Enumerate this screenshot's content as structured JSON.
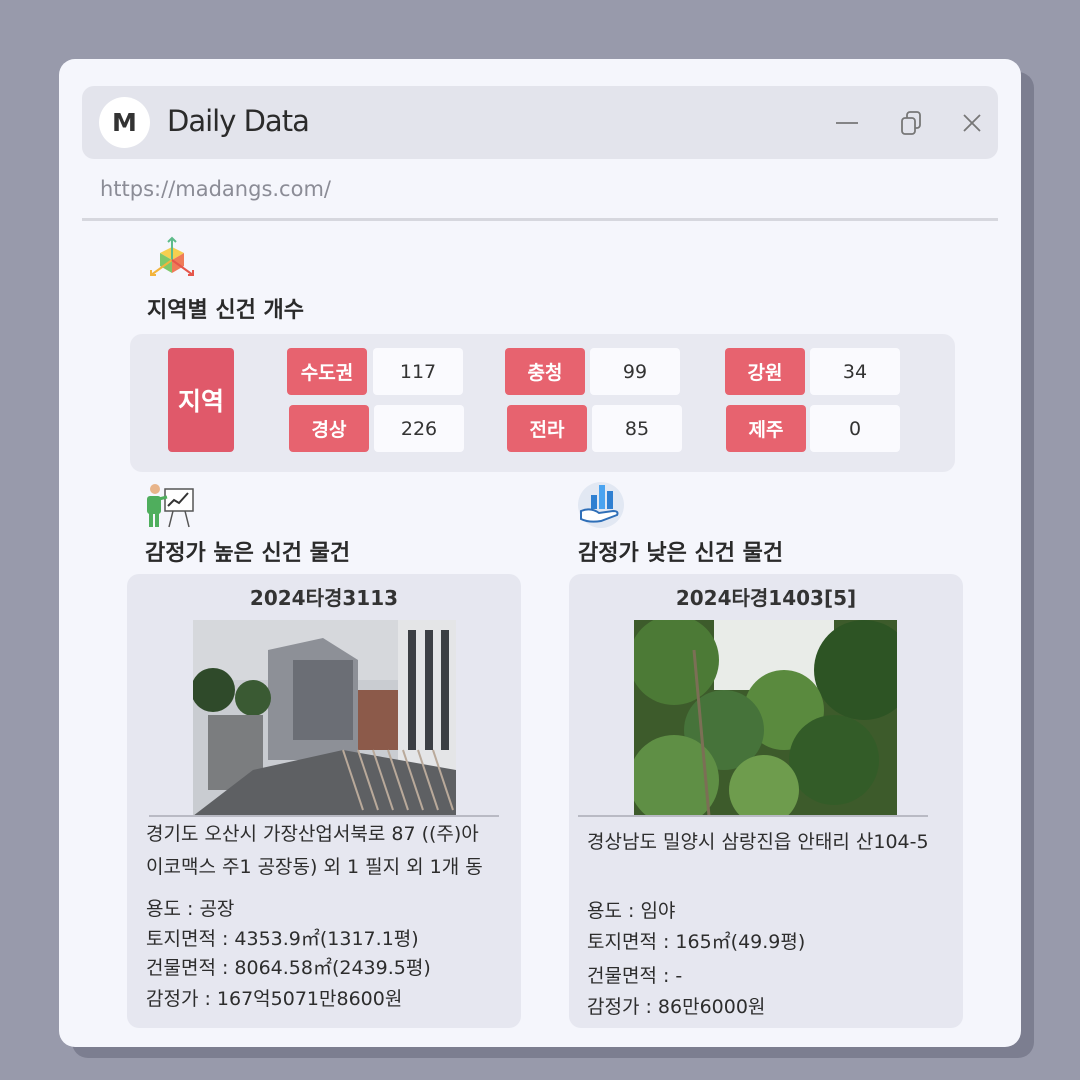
{
  "window": {
    "logo_letter": "M",
    "title": "Daily Data",
    "url": "https://madangs.com/"
  },
  "icons": {
    "minimize": "minimize-icon",
    "restore": "restore-icon",
    "close": "close-icon",
    "region": "cube-axes-icon",
    "high": "presentation-chart-icon",
    "low": "hand-bar-chart-icon"
  },
  "region_section": {
    "title": "지역별 신건 개수",
    "label": "지역",
    "regions": [
      {
        "name": "수도권",
        "count": "117"
      },
      {
        "name": "경상",
        "count": "226"
      },
      {
        "name": "충청",
        "count": "99"
      },
      {
        "name": "전라",
        "count": "85"
      },
      {
        "name": "강원",
        "count": "34"
      },
      {
        "name": "제주",
        "count": "0"
      }
    ]
  },
  "high_item": {
    "section_title": "감정가 높은 신건 물건",
    "case_no": "2024타경3113",
    "address_line1": "경기도 오산시 가장산업서북로 87 ((주)아",
    "address_line2": "이코맥스 주1 공장동) 외 1 필지 외 1개 동",
    "usage": "용도 : 공장",
    "land_area": "토지면적 : 4353.9㎡(1317.1평)",
    "building_area": "건물면적 : 8064.58㎡(2439.5평)",
    "appraisal": "감정가 : 167억5071만8600원"
  },
  "low_item": {
    "section_title": "감정가 낮은 신건 물건",
    "case_no": "2024타경1403[5]",
    "address_line1": "경상남도 밀양시 삼랑진읍 안태리 산104-5",
    "usage": "용도 : 임야",
    "land_area": "토지면적 : 165㎡(49.9평)",
    "building_area": "건물면적 : -",
    "appraisal": "감정가 : 86만6000원"
  },
  "colors": {
    "background": "#989aab",
    "window": "#f5f6fc",
    "accent_red": "#e7636f",
    "panel": "#e8e9f1"
  }
}
